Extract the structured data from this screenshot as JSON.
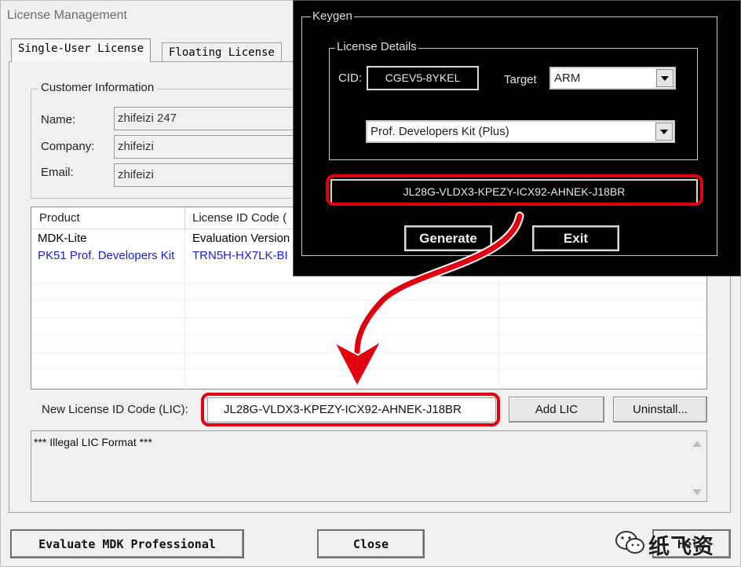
{
  "window": {
    "title": "License Management",
    "tabs": [
      {
        "label": "Single-User License",
        "active": true
      },
      {
        "label": "Floating License",
        "active": false
      }
    ],
    "customer_info": {
      "group_label": "Customer Information",
      "fields": [
        {
          "label": "Name:",
          "value": "zhifeizi 247"
        },
        {
          "label": "Company:",
          "value": "zhifeizi"
        },
        {
          "label": "Email:",
          "value": "zhifeizi"
        }
      ]
    },
    "table": {
      "columns": [
        "Product",
        "License ID Code ("
      ],
      "rows": [
        {
          "product": "MDK-Lite",
          "license": "Evaluation Version",
          "highlight": false
        },
        {
          "product": "PK51 Prof. Developers Kit",
          "license": "TRN5H-HX7LK-BI",
          "highlight": true
        }
      ]
    },
    "new_license": {
      "label": "New License ID Code (LIC):",
      "value": "JL28G-VLDX3-KPEZY-ICX92-AHNEK-J18BR"
    },
    "buttons": {
      "add": "Add LIC",
      "uninstall": "Uninstall...",
      "evaluate": "Evaluate MDK Professional",
      "close": "Close",
      "help": "Help"
    },
    "status_text": "*** Illegal LIC Format ***"
  },
  "keygen": {
    "title": "Keygen",
    "details_label": "License Details",
    "cid_label": "CID:",
    "cid_value": "CGEV5-8YKEL",
    "target_label": "Target",
    "target_value": "ARM",
    "product_value": "Prof. Developers Kit (Plus)",
    "license_code": "JL28G-VLDX3-KPEZY-ICX92-AHNEK-J18BR",
    "generate_label": "Generate",
    "exit_label": "Exit"
  },
  "watermark": {
    "text": "纸飞资"
  },
  "colors": {
    "annotation_red": "#e10010",
    "link_blue": "#1a22d6",
    "keygen_bg": "#000000"
  }
}
